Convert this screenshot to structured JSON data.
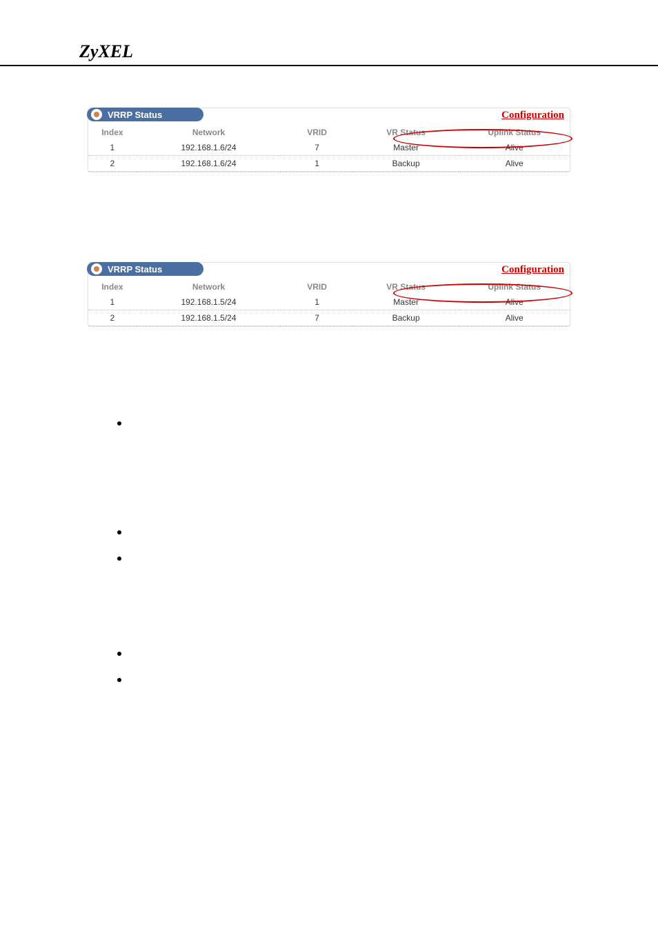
{
  "brand": "ZyXEL",
  "panels": [
    {
      "title": "VRRP Status",
      "config_link": "Configuration",
      "columns": {
        "index": "Index",
        "network": "Network",
        "vrid": "VRID",
        "vr_status": "VR Status",
        "uplink_status": "Uplink Status"
      },
      "rows": [
        {
          "index": "1",
          "network": "192.168.1.6/24",
          "vrid": "7",
          "vr_status": "Master",
          "uplink": "Alive"
        },
        {
          "index": "2",
          "network": "192.168.1.6/24",
          "vrid": "1",
          "vr_status": "Backup",
          "uplink": "Alive"
        }
      ]
    },
    {
      "title": "VRRP Status",
      "config_link": "Configuration",
      "columns": {
        "index": "Index",
        "network": "Network",
        "vrid": "VRID",
        "vr_status": "VR Status",
        "uplink_status": "Uplink Status"
      },
      "rows": [
        {
          "index": "1",
          "network": "192.168.1.5/24",
          "vrid": "1",
          "vr_status": "Master",
          "uplink": "Alive"
        },
        {
          "index": "2",
          "network": "192.168.1.5/24",
          "vrid": "7",
          "vr_status": "Backup",
          "uplink": "Alive"
        }
      ]
    }
  ],
  "bullets": [
    "",
    "",
    "",
    "",
    ""
  ]
}
